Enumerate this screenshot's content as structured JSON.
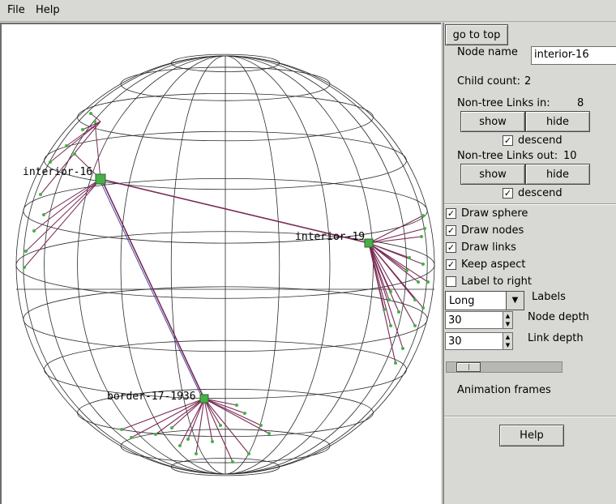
{
  "menu": {
    "file": "File",
    "help": "Help"
  },
  "canvas": {
    "node_labels": [
      "interior-16",
      "interior-19",
      "border-17-1936"
    ],
    "colors": {
      "sphere": "#2a2a2a",
      "link": "#7a2a55",
      "node": "#48b048",
      "link_alt": "#3a3aa0"
    }
  },
  "panel": {
    "go_top": "go to top",
    "node_name_label": "Node name",
    "node_name_value": "interior-16",
    "child_count_label": "Child count:",
    "child_count_value": "2",
    "links_in_label": "Non-tree Links in:",
    "links_in_value": "8",
    "show": "show",
    "hide": "hide",
    "descend": "descend",
    "links_out_label": "Non-tree Links out:",
    "links_out_value": "10",
    "draw_sphere": "Draw sphere",
    "draw_nodes": "Draw nodes",
    "draw_links": "Draw links",
    "keep_aspect": "Keep aspect",
    "label_right": "Label to right",
    "labels_combo": "Long",
    "labels_label": "Labels",
    "node_depth_value": "30",
    "node_depth_label": "Node depth",
    "link_depth_value": "30",
    "link_depth_label": "Link depth",
    "anim_frames_label": "Animation frames",
    "help_button": "Help",
    "checks": {
      "in_descend": true,
      "out_descend": true,
      "draw_sphere": true,
      "draw_nodes": true,
      "draw_links": true,
      "keep_aspect": true,
      "label_right": false
    },
    "check_mark": "✓"
  }
}
